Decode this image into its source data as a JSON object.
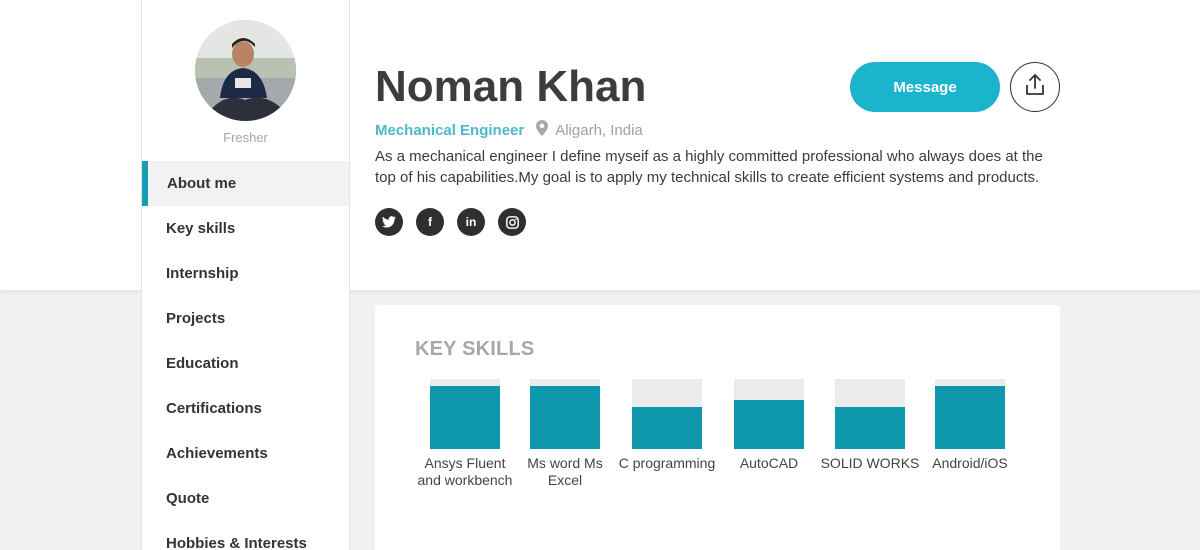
{
  "profile": {
    "name": "Noman Khan",
    "role": "Mechanical Engineer",
    "location": "Aligarh, India",
    "status": "Fresher",
    "about": "As a mechanical engineer I define myseif as a highly committed professional who always does at the top of his capabilities.My goal is to apply my technical skills to create efficient systems and products."
  },
  "actions": {
    "message_label": "Message",
    "share_icon": "share-upload-icon"
  },
  "socials": [
    {
      "name": "twitter",
      "glyph": "t"
    },
    {
      "name": "facebook",
      "glyph": "f"
    },
    {
      "name": "linkedin",
      "glyph": "in"
    },
    {
      "name": "instagram",
      "glyph": "ig"
    }
  ],
  "nav": {
    "items": [
      {
        "label": "About me",
        "active": true
      },
      {
        "label": "Key skills"
      },
      {
        "label": "Internship"
      },
      {
        "label": "Projects"
      },
      {
        "label": "Education"
      },
      {
        "label": "Certifications"
      },
      {
        "label": "Achievements"
      },
      {
        "label": "Quote"
      },
      {
        "label": "Hobbies & Interests"
      }
    ]
  },
  "key_skills": {
    "title": "KEY SKILLS",
    "items": [
      {
        "label": "Ansys Fluent and workbench",
        "level": 0.9
      },
      {
        "label": "Ms word Ms Excel",
        "level": 0.9
      },
      {
        "label": "C programming",
        "level": 0.6
      },
      {
        "label": "AutoCAD",
        "level": 0.7
      },
      {
        "label": "SOLID WORKS",
        "level": 0.6
      },
      {
        "label": "Android/iOS",
        "level": 0.9
      }
    ]
  },
  "colors": {
    "accent": "#1cb4cc",
    "bar": "#0f97ad",
    "role": "#4cb9cc"
  }
}
